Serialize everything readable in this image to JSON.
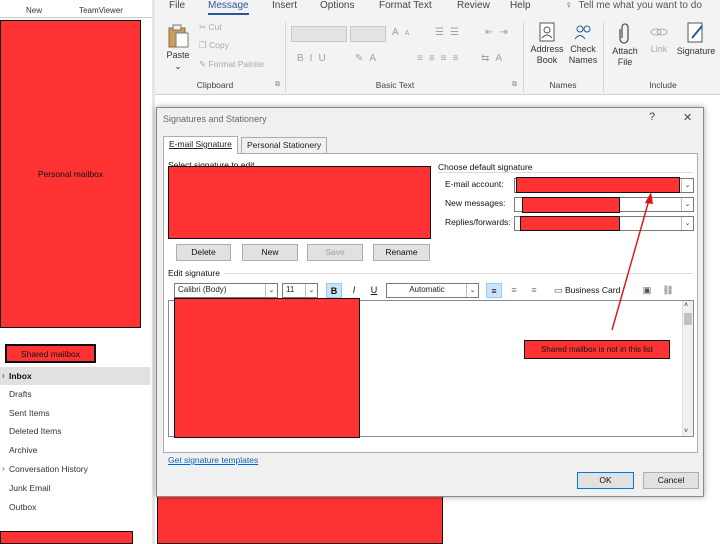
{
  "left_pane": {
    "new_label": "New",
    "teamviewer_label": "TeamViewer",
    "personal_mailbox_label": "Personal mailbox",
    "shared_mailbox_label": "Shared mailbox",
    "folders": [
      {
        "label": "Inbox",
        "selected": true,
        "expand": true
      },
      {
        "label": "Drafts"
      },
      {
        "label": "Sent Items"
      },
      {
        "label": "Deleted Items"
      },
      {
        "label": "Archive"
      },
      {
        "label": "Conversation History",
        "expand": true
      },
      {
        "label": "Junk Email"
      },
      {
        "label": "Outbox"
      }
    ]
  },
  "ribbon": {
    "tabs": [
      "File",
      "Message",
      "Insert",
      "Options",
      "Format Text",
      "Review",
      "Help"
    ],
    "active_tab": "Message",
    "tell_me": "Tell me what you want to do",
    "clipboard": {
      "paste": "Paste",
      "cut": "Cut",
      "copy": "Copy",
      "format_painter": "Format Painter",
      "group": "Clipboard"
    },
    "basic_text": {
      "group": "Basic Text"
    },
    "names": {
      "address_book": "Address Book",
      "check_names": "Check Names",
      "group": "Names"
    },
    "include": {
      "attach_file": "Attach File",
      "link": "Link",
      "signature": "Signature",
      "group": "Include"
    }
  },
  "dialog": {
    "title": "Signatures and Stationery",
    "help": "?",
    "close": "✕",
    "tabs": [
      "E-mail Signature",
      "Personal Stationery"
    ],
    "select_label": "Select signature to edit",
    "buttons": {
      "delete": "Delete",
      "new": "New",
      "save": "Save",
      "rename": "Rename"
    },
    "default_signature": {
      "heading": "Choose default signature",
      "email_account": "E-mail account:",
      "new_messages": "New messages:",
      "replies": "Replies/forwards:"
    },
    "edit_heading": "Edit signature",
    "font": "Calibri (Body)",
    "size": "11",
    "bold": "B",
    "italic": "I",
    "underline": "U",
    "color": "Automatic",
    "business_card": "Business Card",
    "callout": "Shared mailbox is not in this list",
    "templates_link": "Get signature templates",
    "ok": "OK",
    "cancel": "Cancel"
  },
  "colors": {
    "redaction": "#ff3333",
    "accent": "#2b579a",
    "link": "#0066cc"
  }
}
